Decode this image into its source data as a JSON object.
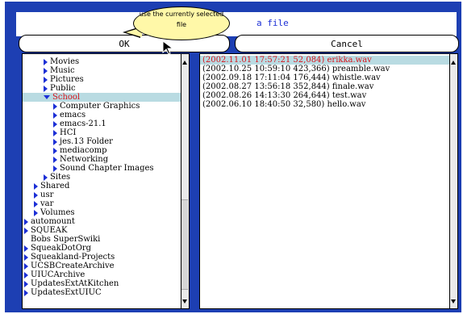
{
  "title": "a file",
  "buttons": {
    "ok": "OK",
    "cancel": "Cancel"
  },
  "tooltip": {
    "line1": "use the currently selected",
    "line2": "file"
  },
  "folders": [
    {
      "label": "Movies",
      "indent": 2,
      "icon": "right"
    },
    {
      "label": "Music",
      "indent": 2,
      "icon": "right"
    },
    {
      "label": "Pictures",
      "indent": 2,
      "icon": "right"
    },
    {
      "label": "Public",
      "indent": 2,
      "icon": "right"
    },
    {
      "label": "School",
      "indent": 2,
      "icon": "down",
      "selected": true
    },
    {
      "label": "Computer Graphics",
      "indent": 3,
      "icon": "right"
    },
    {
      "label": "emacs",
      "indent": 3,
      "icon": "right"
    },
    {
      "label": "emacs-21.1",
      "indent": 3,
      "icon": "right"
    },
    {
      "label": "HCI",
      "indent": 3,
      "icon": "right"
    },
    {
      "label": "jes.13 Folder",
      "indent": 3,
      "icon": "right"
    },
    {
      "label": "mediacomp",
      "indent": 3,
      "icon": "right"
    },
    {
      "label": "Networking",
      "indent": 3,
      "icon": "right"
    },
    {
      "label": "Sound Chapter Images",
      "indent": 3,
      "icon": "right"
    },
    {
      "label": "Sites",
      "indent": 2,
      "icon": "right"
    },
    {
      "label": "Shared",
      "indent": 1,
      "icon": "right"
    },
    {
      "label": "usr",
      "indent": 1,
      "icon": "right"
    },
    {
      "label": "var",
      "indent": 1,
      "icon": "right"
    },
    {
      "label": "Volumes",
      "indent": 1,
      "icon": "right"
    },
    {
      "label": "automount",
      "indent": 0,
      "icon": "right"
    },
    {
      "label": "SQUEAK",
      "indent": 0,
      "icon": "right"
    },
    {
      "label": "Bobs SuperSwiki",
      "indent": 0,
      "icon": "none"
    },
    {
      "label": "SqueakDotOrg",
      "indent": 0,
      "icon": "right"
    },
    {
      "label": "Squeakland-Projects",
      "indent": 0,
      "icon": "right"
    },
    {
      "label": "UCSBCreateArchive",
      "indent": 0,
      "icon": "right"
    },
    {
      "label": "UIUCArchive",
      "indent": 0,
      "icon": "right"
    },
    {
      "label": "UpdatesExtAtKitchen",
      "indent": 0,
      "icon": "right"
    },
    {
      "label": "UpdatesExtUIUC",
      "indent": 0,
      "icon": "right"
    }
  ],
  "files": [
    {
      "label": "(2002.11.01 17:57:21 52,084) erikka.wav",
      "selected": true
    },
    {
      "label": "(2002.10.25 10:59:10 423,366) preamble.wav"
    },
    {
      "label": "(2002.09.18 17:11:04 176,444) whistle.wav"
    },
    {
      "label": "(2002.08.27 13:56:18 352,844) finale.wav"
    },
    {
      "label": "(2002.08.26 14:13:30 264,644) test.wav"
    },
    {
      "label": "(2002.06.10 18:40:50 32,580) hello.wav"
    }
  ]
}
